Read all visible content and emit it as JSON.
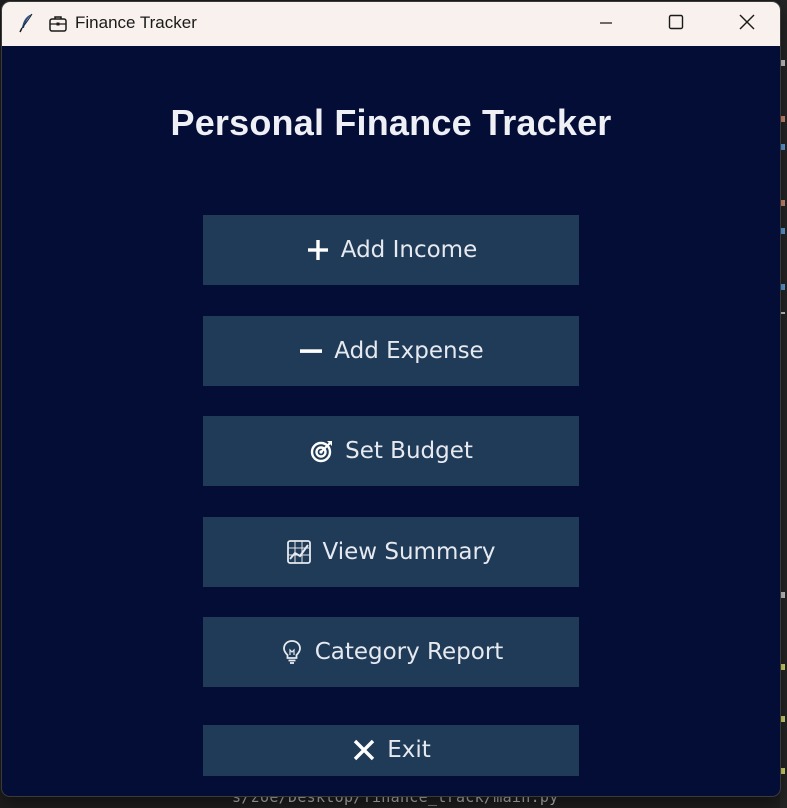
{
  "window": {
    "title": "Finance Tracker",
    "title_icons": [
      "feather-icon",
      "briefcase-icon"
    ],
    "controls": [
      "minimize-icon",
      "maximize-icon",
      "close-icon"
    ]
  },
  "main": {
    "heading": "Personal Finance Tracker",
    "buttons": [
      {
        "label": "Add Income",
        "icon": "plus-icon"
      },
      {
        "label": "Add Expense",
        "icon": "minus-icon"
      },
      {
        "label": "Set Budget",
        "icon": "target-icon"
      },
      {
        "label": "View Summary",
        "icon": "chart-icon"
      },
      {
        "label": "Category Report",
        "icon": "lightbulb-icon"
      },
      {
        "label": "Exit",
        "icon": "x-icon"
      }
    ]
  },
  "background": {
    "terminal_text": "s/zoe/Desktop/finance_track/main.py"
  },
  "colors": {
    "window_bg": "#040d35",
    "titlebar_bg": "#f8f1ed",
    "button_bg": "#1f3b57",
    "button_text": "#e6e9ef",
    "heading_text": "#eef0f6"
  }
}
